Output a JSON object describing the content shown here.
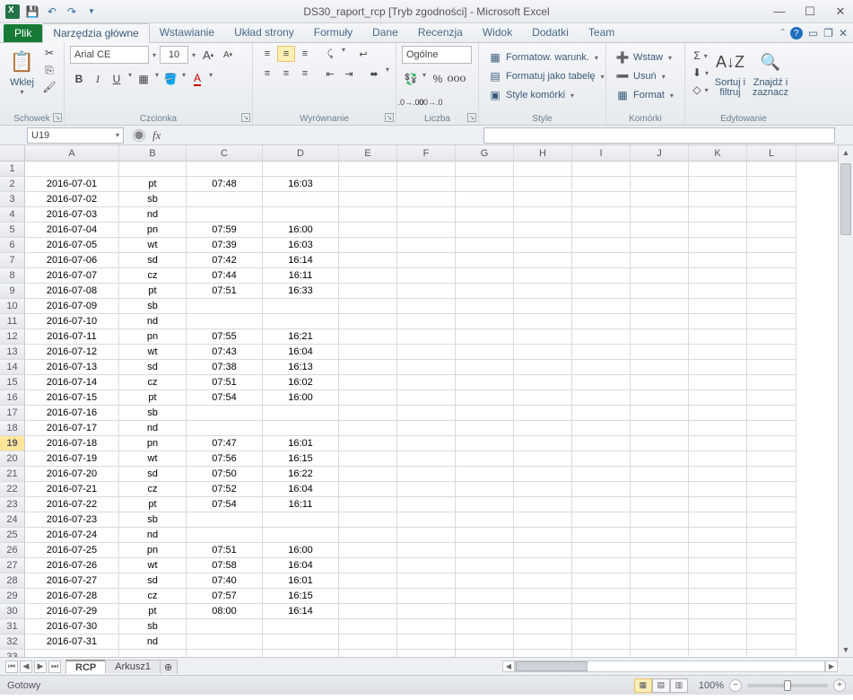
{
  "title": "DS30_raport_rcp  [Tryb zgodności] - Microsoft Excel",
  "tabs": {
    "file": "Plik",
    "items": [
      "Narzędzia główne",
      "Wstawianie",
      "Układ strony",
      "Formuły",
      "Dane",
      "Recenzja",
      "Widok",
      "Dodatki",
      "Team"
    ],
    "active": 0
  },
  "ribbon": {
    "clipboard": {
      "title": "Schowek",
      "paste": "Wklej"
    },
    "font": {
      "title": "Czcionka",
      "name": "Arial CE",
      "size": "10"
    },
    "alignment": {
      "title": "Wyrównanie"
    },
    "number": {
      "title": "Liczba",
      "format": "Ogólne"
    },
    "styles": {
      "title": "Style",
      "cond": "Formatow. warunk.",
      "table": "Formatuj jako tabelę",
      "cell": "Style komórki"
    },
    "cells": {
      "title": "Komórki",
      "insert": "Wstaw",
      "delete": "Usuń",
      "format": "Format"
    },
    "editing": {
      "title": "Edytowanie",
      "sort": "Sortuj i\nfiltruj",
      "find": "Znajdź i\nzaznacz"
    }
  },
  "namebox": "U19",
  "fx": "fx",
  "columns": [
    "A",
    "B",
    "C",
    "D",
    "E",
    "F",
    "G",
    "H",
    "I",
    "J",
    "K",
    "L"
  ],
  "col_widths": [
    "wA",
    "wB",
    "wC",
    "wD",
    "wE",
    "wF",
    "wG",
    "wH",
    "wI",
    "wJ",
    "wK",
    "wL"
  ],
  "selected_row": 19,
  "rows": [
    {
      "n": 1,
      "a": "",
      "b": "",
      "c": "",
      "d": ""
    },
    {
      "n": 2,
      "a": "2016-07-01",
      "b": "pt",
      "c": "07:48",
      "d": "16:03"
    },
    {
      "n": 3,
      "a": "2016-07-02",
      "b": "sb",
      "c": "",
      "d": ""
    },
    {
      "n": 4,
      "a": "2016-07-03",
      "b": "nd",
      "c": "",
      "d": ""
    },
    {
      "n": 5,
      "a": "2016-07-04",
      "b": "pn",
      "c": "07:59",
      "d": "16:00"
    },
    {
      "n": 6,
      "a": "2016-07-05",
      "b": "wt",
      "c": "07:39",
      "d": "16:03"
    },
    {
      "n": 7,
      "a": "2016-07-06",
      "b": "sd",
      "c": "07:42",
      "d": "16:14"
    },
    {
      "n": 8,
      "a": "2016-07-07",
      "b": "cz",
      "c": "07:44",
      "d": "16:11"
    },
    {
      "n": 9,
      "a": "2016-07-08",
      "b": "pt",
      "c": "07:51",
      "d": "16:33"
    },
    {
      "n": 10,
      "a": "2016-07-09",
      "b": "sb",
      "c": "",
      "d": ""
    },
    {
      "n": 11,
      "a": "2016-07-10",
      "b": "nd",
      "c": "",
      "d": ""
    },
    {
      "n": 12,
      "a": "2016-07-11",
      "b": "pn",
      "c": "07:55",
      "d": "16:21"
    },
    {
      "n": 13,
      "a": "2016-07-12",
      "b": "wt",
      "c": "07:43",
      "d": "16:04"
    },
    {
      "n": 14,
      "a": "2016-07-13",
      "b": "sd",
      "c": "07:38",
      "d": "16:13"
    },
    {
      "n": 15,
      "a": "2016-07-14",
      "b": "cz",
      "c": "07:51",
      "d": "16:02"
    },
    {
      "n": 16,
      "a": "2016-07-15",
      "b": "pt",
      "c": "07:54",
      "d": "16:00"
    },
    {
      "n": 17,
      "a": "2016-07-16",
      "b": "sb",
      "c": "",
      "d": ""
    },
    {
      "n": 18,
      "a": "2016-07-17",
      "b": "nd",
      "c": "",
      "d": ""
    },
    {
      "n": 19,
      "a": "2016-07-18",
      "b": "pn",
      "c": "07:47",
      "d": "16:01"
    },
    {
      "n": 20,
      "a": "2016-07-19",
      "b": "wt",
      "c": "07:56",
      "d": "16:15"
    },
    {
      "n": 21,
      "a": "2016-07-20",
      "b": "sd",
      "c": "07:50",
      "d": "16:22"
    },
    {
      "n": 22,
      "a": "2016-07-21",
      "b": "cz",
      "c": "07:52",
      "d": "16:04"
    },
    {
      "n": 23,
      "a": "2016-07-22",
      "b": "pt",
      "c": "07:54",
      "d": "16:11"
    },
    {
      "n": 24,
      "a": "2016-07-23",
      "b": "sb",
      "c": "",
      "d": ""
    },
    {
      "n": 25,
      "a": "2016-07-24",
      "b": "nd",
      "c": "",
      "d": ""
    },
    {
      "n": 26,
      "a": "2016-07-25",
      "b": "pn",
      "c": "07:51",
      "d": "16:00"
    },
    {
      "n": 27,
      "a": "2016-07-26",
      "b": "wt",
      "c": "07:58",
      "d": "16:04"
    },
    {
      "n": 28,
      "a": "2016-07-27",
      "b": "sd",
      "c": "07:40",
      "d": "16:01"
    },
    {
      "n": 29,
      "a": "2016-07-28",
      "b": "cz",
      "c": "07:57",
      "d": "16:15"
    },
    {
      "n": 30,
      "a": "2016-07-29",
      "b": "pt",
      "c": "08:00",
      "d": "16:14"
    },
    {
      "n": 31,
      "a": "2016-07-30",
      "b": "sb",
      "c": "",
      "d": ""
    },
    {
      "n": 32,
      "a": "2016-07-31",
      "b": "nd",
      "c": "",
      "d": ""
    },
    {
      "n": 33,
      "a": "",
      "b": "",
      "c": "",
      "d": ""
    }
  ],
  "sheets": {
    "active": "RCP",
    "others": [
      "Arkusz1"
    ]
  },
  "status": {
    "ready": "Gotowy",
    "zoom": "100%"
  }
}
